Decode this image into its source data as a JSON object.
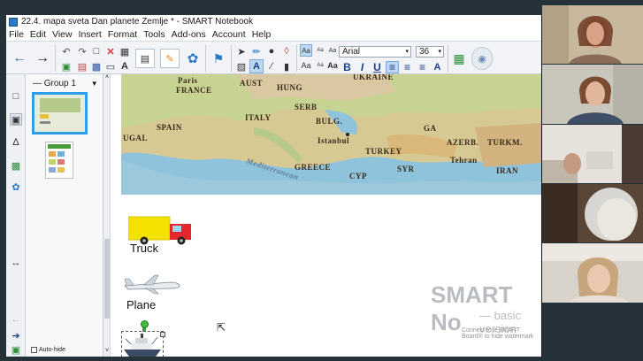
{
  "window": {
    "title": "22.4. mapa sveta Dan planete Zemlje * - SMART Notebook"
  },
  "menu": [
    "File",
    "Edit",
    "View",
    "Insert",
    "Format",
    "Tools",
    "Add-ons",
    "Account",
    "Help"
  ],
  "toolbar": {
    "font_name": "Arial",
    "font_size": "36",
    "bold": "B",
    "italic": "I",
    "underline": "U",
    "small_aa": "Aa"
  },
  "sorter": {
    "group_label": "Group 1",
    "autohide_label": "Auto-hide"
  },
  "map": {
    "labels": [
      "Paris",
      "FRANCE",
      "AUST",
      "HUNG",
      "UKRAINE",
      "SERB",
      "BULG.",
      "ITALY",
      "SPAIN",
      "UGAL",
      "Istanbul",
      "TURKEY",
      "GREECE",
      "SYR",
      "CYP",
      "AZERB.",
      "TURKM.",
      "Tehran",
      "IRAN",
      "Mediterranean",
      "GA"
    ]
  },
  "canvas": {
    "items": [
      "Truck",
      "Plane"
    ]
  },
  "watermark": {
    "title": "SMART No",
    "subtitle": "— basic version",
    "note": "Connect to a SMART Board® to hide watermark"
  }
}
